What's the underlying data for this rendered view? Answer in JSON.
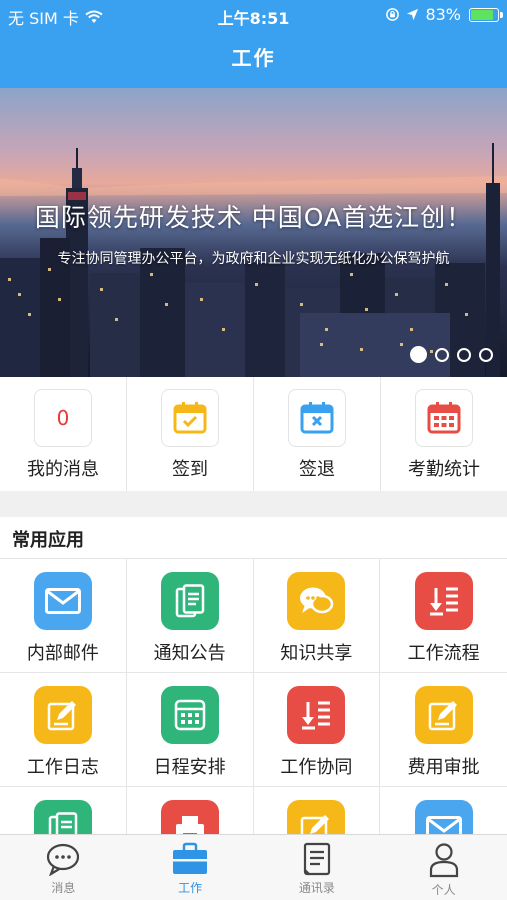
{
  "status_bar": {
    "carrier": "无 SIM 卡",
    "time": "上午8:51",
    "battery": "83%",
    "battery_level": 0.83
  },
  "nav": {
    "title": "工作"
  },
  "banner": {
    "headline": "国际领先研发技术  中国OA首选江创！",
    "subline": "专注协同管理办公平台，为政府和企业实现无纸化办公保驾护航",
    "slides": 4,
    "active_slide": 1
  },
  "quick": [
    {
      "label": "我的消息",
      "count": "0",
      "icon": "message-count-icon"
    },
    {
      "label": "签到",
      "icon": "calendar-check-icon",
      "color": "#f6b819"
    },
    {
      "label": "签退",
      "icon": "calendar-x-icon",
      "color": "#3aa0f0"
    },
    {
      "label": "考勤统计",
      "icon": "calendar-grid-icon",
      "color": "#e84d45"
    }
  ],
  "section": {
    "title": "常用应用"
  },
  "apps": [
    {
      "label": "内部邮件",
      "icon": "mail-icon",
      "color": "#4aa6ef"
    },
    {
      "label": "通知公告",
      "icon": "notice-icon",
      "color": "#2fb57a"
    },
    {
      "label": "知识共享",
      "icon": "chat-bubble-icon",
      "color": "#f6b819"
    },
    {
      "label": "工作流程",
      "icon": "flow-list-icon",
      "color": "#e84d45"
    },
    {
      "label": "工作日志",
      "icon": "edit-log-icon",
      "color": "#f6b819"
    },
    {
      "label": "日程安排",
      "icon": "schedule-icon",
      "color": "#2fb57a"
    },
    {
      "label": "工作协同",
      "icon": "flow-list-icon",
      "color": "#e84d45"
    },
    {
      "label": "费用审批",
      "icon": "edit-log-icon",
      "color": "#f6b819"
    },
    {
      "label": "",
      "icon": "document-icon",
      "color": "#2fb57a"
    },
    {
      "label": "",
      "icon": "printer-icon",
      "color": "#e84d45"
    },
    {
      "label": "",
      "icon": "edit-log-icon",
      "color": "#f6b819"
    },
    {
      "label": "",
      "icon": "mail-icon",
      "color": "#4aa6ef"
    }
  ],
  "tabs": [
    {
      "label": "消息",
      "icon": "chat-icon",
      "active": false
    },
    {
      "label": "工作",
      "icon": "briefcase-icon",
      "active": true
    },
    {
      "label": "通讯录",
      "icon": "contacts-icon",
      "active": false
    },
    {
      "label": "个人",
      "icon": "person-icon",
      "active": false
    }
  ]
}
